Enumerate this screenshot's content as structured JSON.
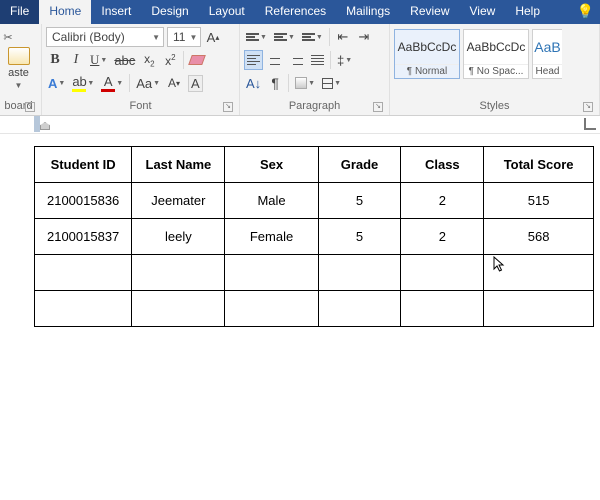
{
  "tabs": {
    "file": "File",
    "home": "Home",
    "insert": "Insert",
    "design": "Design",
    "layout": "Layout",
    "references": "References",
    "mailings": "Mailings",
    "review": "Review",
    "view": "View",
    "help": "Help"
  },
  "font": {
    "name": "Calibri (Body)",
    "size": "11"
  },
  "groups": {
    "clipboard": "board",
    "font": "Font",
    "paragraph": "Paragraph",
    "styles": "Styles"
  },
  "clipboard": {
    "paste_hint": "aste"
  },
  "styles": {
    "preview": "AaBbCcDc",
    "normal": "¶ Normal",
    "nospacing": "¶ No Spac...",
    "heading_preview": "AaB",
    "heading": "Head"
  },
  "table": {
    "headers": [
      "Student ID",
      "Last Name",
      "Sex",
      "Grade",
      "Class",
      "Total Score"
    ],
    "rows": [
      [
        "2100015836",
        "Jeemater",
        "Male",
        "5",
        "2",
        "515"
      ],
      [
        "2100015837",
        "leely",
        "Female",
        "5",
        "2",
        "568"
      ],
      [
        "",
        "",
        "",
        "",
        "",
        ""
      ],
      [
        "",
        "",
        "",
        "",
        "",
        ""
      ]
    ]
  }
}
